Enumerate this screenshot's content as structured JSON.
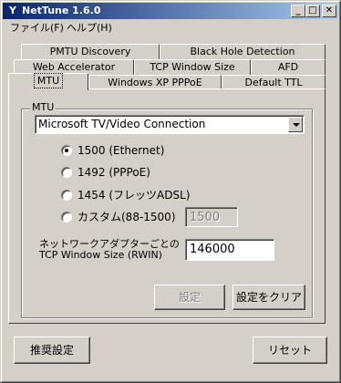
{
  "window": {
    "title": "NetTune 1.6.0",
    "title_icon": "Y"
  },
  "caption_buttons": {
    "minimize": "_",
    "maximize": "□",
    "close": "✕"
  },
  "menu": [
    {
      "label": "ファイル(F)"
    },
    {
      "label": "ヘルプ(H)"
    }
  ],
  "tabs": {
    "row1": [
      "PMTU Discovery",
      "Black Hole Detection"
    ],
    "row2": [
      "Web Accelerator",
      "TCP Window Size",
      "AFD"
    ],
    "row3": [
      "MTU",
      "Windows XP PPPoE",
      "Default TTL"
    ],
    "active": "MTU"
  },
  "mtu": {
    "group_label": "MTU",
    "adapter_selected": "Microsoft TV/Video Connection",
    "options": [
      {
        "label": "1500 (Ethernet)",
        "selected": true
      },
      {
        "label": "1492 (PPPoE)",
        "selected": false
      },
      {
        "label": "1454 (フレッツADSL)",
        "selected": false
      },
      {
        "label": "カスタム(88-1500)",
        "selected": false
      }
    ],
    "custom_value": "1500",
    "rwin_label_line1": "ネットワークアダプターごとの",
    "rwin_label_line2": "TCP Window Size (RWIN)",
    "rwin_value": "146000",
    "apply_button": "設定",
    "clear_button": "設定をクリア"
  },
  "footer": {
    "recommended_button": "推奨設定",
    "reset_button": "リセット"
  }
}
